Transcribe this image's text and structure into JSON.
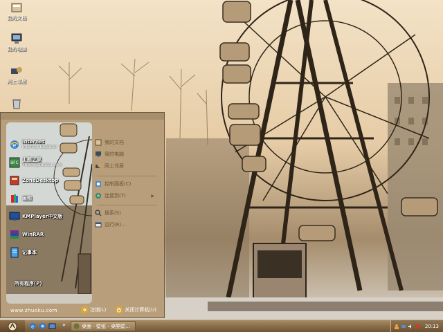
{
  "desktop": {
    "icons": [
      {
        "label": "我的文档",
        "icon": "my-documents-icon"
      },
      {
        "label": "我的电脑",
        "icon": "my-computer-icon"
      },
      {
        "label": "网上邻居",
        "icon": "network-places-icon"
      },
      {
        "label": "",
        "icon": "recycle-bin-icon"
      }
    ]
  },
  "start_menu": {
    "programs": [
      {
        "title": "Internet",
        "subtitle": "Internet Explorer",
        "icon": "ie-icon"
      },
      {
        "title": "主题之家",
        "subtitle": "ThemeZhuoku.com",
        "icon": "theme-icon"
      },
      {
        "title": "ZoneDesktop",
        "subtitle": "",
        "icon": "zone-icon"
      },
      {
        "title": "画图",
        "subtitle": "",
        "icon": "paint-icon"
      },
      {
        "title": "KMPlayer中文版",
        "subtitle": "",
        "icon": "kmplayer-icon"
      },
      {
        "title": "WinRAR",
        "subtitle": "",
        "icon": "winrar-icon"
      },
      {
        "title": "记事本",
        "subtitle": "",
        "icon": "notepad-icon"
      }
    ],
    "all_programs": "所有程序(P)",
    "places": [
      {
        "label": "我的文档",
        "icon": "my-documents-icon"
      },
      {
        "label": "我的电脑",
        "icon": "my-computer-icon"
      },
      {
        "label": "网上邻居",
        "icon": "network-places-icon"
      },
      {
        "label": "控制面板(C)",
        "icon": "control-panel-icon"
      },
      {
        "label": "连接到(T)",
        "icon": "connect-to-icon"
      },
      {
        "label": "搜索(S)",
        "icon": "search-icon"
      },
      {
        "label": "运行(R)...",
        "icon": "run-icon"
      }
    ],
    "url": "www.zhuoku.com",
    "logoff_label": "注销(L)",
    "shutdown_label": "关闭计算机(U)"
  },
  "taskbar": {
    "task_label": "桌面 - 壁纸 - 桌酷壁...",
    "clock": "20:13"
  },
  "colors": {
    "menu_bg": "#b89e7a",
    "taskbar": "#8a6e4a",
    "menu_text": "#6b5638"
  }
}
